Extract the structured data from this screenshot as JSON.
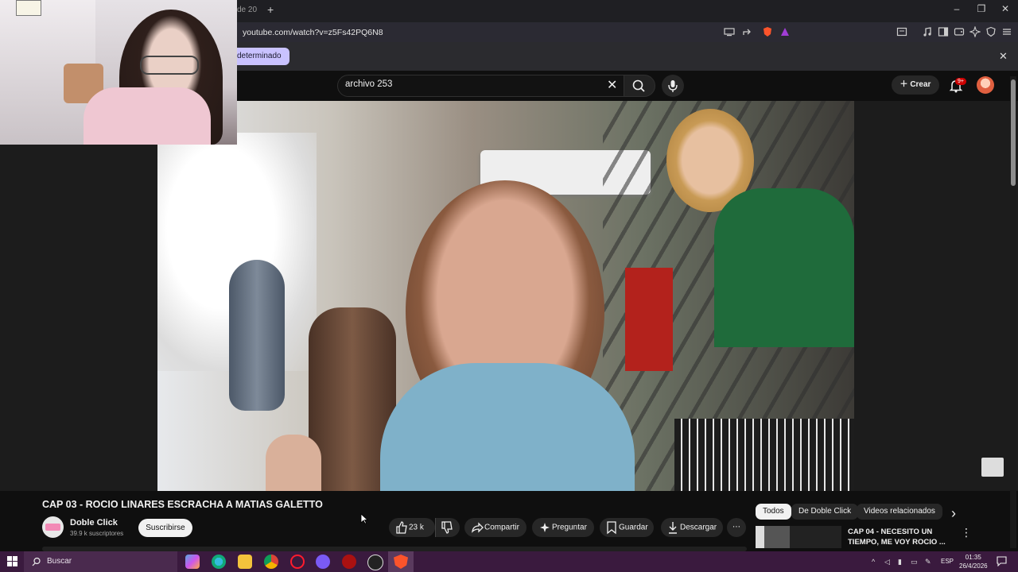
{
  "browser": {
    "tab_partial": "de 20",
    "new_tab": "+",
    "window_controls": {
      "minimize": "–",
      "restore": "❐",
      "close": "✕"
    },
    "url": "youtube.com/watch?v=z5Fs42PQ6N8",
    "infobar_button": "determinado",
    "infobar_close": "✕"
  },
  "youtube": {
    "search_value": "archivo 253",
    "search_clear": "✕",
    "create_label": "Crear",
    "notification_count": "9+",
    "video": {
      "title": "CAP 03 - ROCIO LINARES ESCRACHA A MATIAS GALETTO",
      "channel_name": "Doble Click",
      "subscribers": "39.9 k suscriptores",
      "subscribe_label": "Suscribirse",
      "likes": "23 k",
      "share_label": "Compartir",
      "ask_label": "Preguntar",
      "save_label": "Guardar",
      "download_label": "Descargar",
      "more": "⋯"
    },
    "chips": [
      "Todos",
      "De Doble Click",
      "Videos relacionados"
    ],
    "chips_next": "›",
    "related": {
      "title": "CAP 04 - NECESITO UN TIEMPO, ME VOY ROCIO ...",
      "menu": "⋮"
    }
  },
  "taskbar": {
    "search_placeholder": "Buscar",
    "language": "ESP",
    "time": "01:35",
    "date": "26/4/2026"
  },
  "colors": {
    "youtube_bg": "#0f0f0f",
    "taskbar": "#3a1a3e",
    "infobar_button": "#c9c2ff",
    "badge": "#cc0000"
  }
}
